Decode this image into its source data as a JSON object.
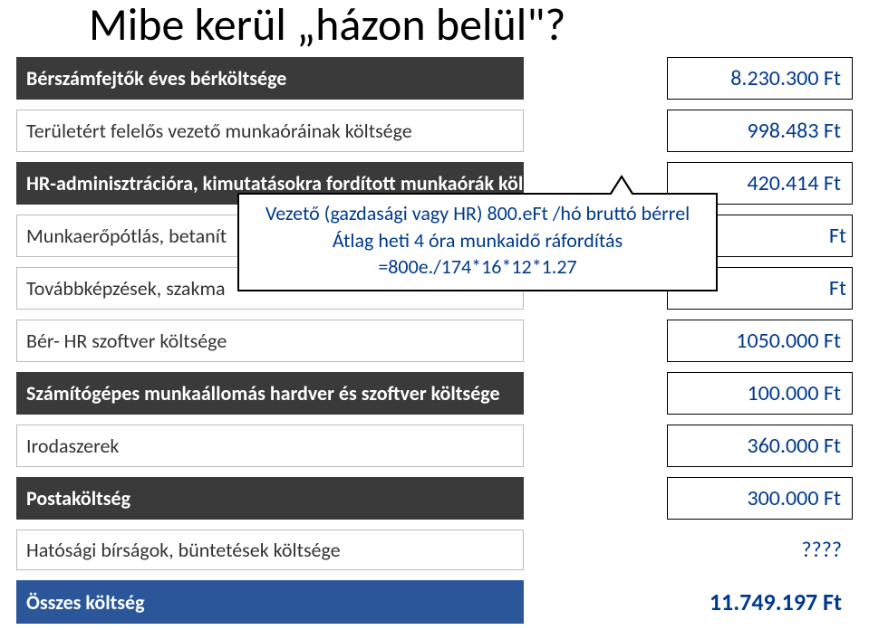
{
  "title": "Mibe kerül „házon belül\"?",
  "rows": [
    {
      "label": "Bérszámfejtők  éves bérköltsége",
      "amount": "8.230.300 Ft",
      "dark": true
    },
    {
      "label": "Területért felelős vezető munkaóráinak költsége",
      "amount": "998.483 Ft",
      "dark": false
    },
    {
      "label": "HR-adminisztrációra, kimutatásokra fordított munkaórák költsége",
      "amount": "420.414 Ft",
      "dark": true
    },
    {
      "label": "Munkaerőpótlás, betanít",
      "amount": "Ft",
      "dark": false
    },
    {
      "label": "Továbbképzések, szakma",
      "amount": "Ft",
      "dark": false
    },
    {
      "label": "Bér- HR szoftver költsége",
      "amount": "1050.000 Ft",
      "dark": false
    },
    {
      "label": "Számítógépes munkaállomás hardver és szoftver költsége",
      "amount": "100.000 Ft",
      "dark": true
    },
    {
      "label": "Irodaszerek",
      "amount": "360.000 Ft",
      "dark": false
    },
    {
      "label": "Postaköltség",
      "amount": "300.000 Ft",
      "dark": true
    },
    {
      "label": "Hatósági bírságok, büntetések költsége",
      "amount": "????",
      "dark": false
    }
  ],
  "total": {
    "label": "Összes költség",
    "amount": "11.749.197 Ft"
  },
  "callout": {
    "line1": "Vezető (gazdasági vagy HR) 800.eFt /hó bruttó bérrel",
    "line2": "Átlag heti 4 óra munkaidő ráfordítás",
    "line3": "=800e./174*16*12*1.27"
  }
}
